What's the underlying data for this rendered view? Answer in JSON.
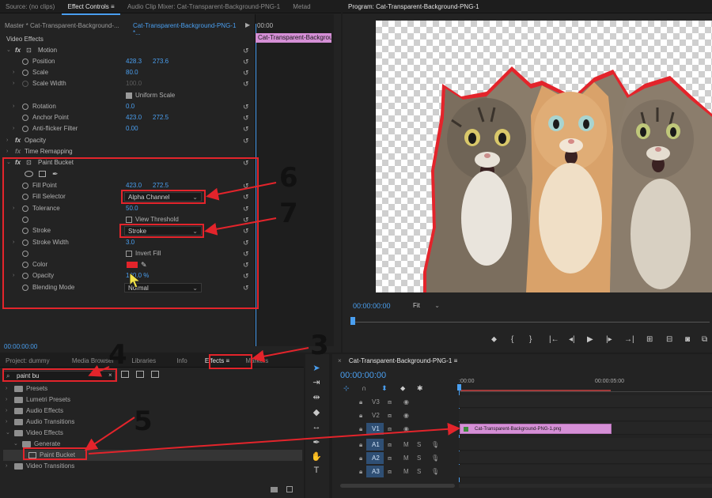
{
  "ec": {
    "tabs": [
      "Source: (no clips)",
      "Effect Controls",
      "Audio Clip Mixer: Cat-Transparent-Background-PNG-1",
      "Metad"
    ],
    "master": "Master * Cat-Transparent-Background-...",
    "sequence_dd": "Cat-Transparent-Background-PNG-1 *...",
    "timeline_time": "00:00",
    "clip_label": "Cat-Transparent-Backgrour",
    "section": "Video Effects",
    "motion": "Motion",
    "position": {
      "label": "Position",
      "x": "428.3",
      "y": "273.6"
    },
    "scale": {
      "label": "Scale",
      "v": "80.0"
    },
    "scale_width": {
      "label": "Scale Width",
      "v": "100.0"
    },
    "uniform_scale": "Uniform Scale",
    "rotation": {
      "label": "Rotation",
      "v": "0.0"
    },
    "anchor": {
      "label": "Anchor Point",
      "x": "423.0",
      "y": "272.5"
    },
    "antiflicker": {
      "label": "Anti-flicker Filter",
      "v": "0.00"
    },
    "opacity": "Opacity",
    "time_remap": "Time Remapping",
    "paint_bucket": "Paint Bucket",
    "fill_point": {
      "label": "Fill Point",
      "x": "423.0",
      "y": "272.5"
    },
    "fill_selector": {
      "label": "Fill Selector",
      "v": "Alpha Channel"
    },
    "tolerance": {
      "label": "Tolerance",
      "v": "50.0"
    },
    "view_threshold": "View Threshold",
    "stroke": {
      "label": "Stroke",
      "v": "Stroke"
    },
    "stroke_width": {
      "label": "Stroke Width",
      "v": "3.0"
    },
    "invert_fill": "Invert Fill",
    "color": {
      "label": "Color",
      "swatch": "#e3242b"
    },
    "pb_opacity": {
      "label": "Opacity",
      "v": "100.0 %"
    },
    "blend": {
      "label": "Blending Mode",
      "v": "Normal"
    },
    "timecode": "00:00:00:00"
  },
  "program": {
    "title": "Program: Cat-Transparent-Background-PNG-1",
    "timecode": "00:00:00:00",
    "fit": "Fit"
  },
  "project": {
    "tabs": [
      "Project: dummy",
      "Media Browser",
      "Libraries",
      "Info",
      "Effects",
      "Markers"
    ],
    "search": "paint bu",
    "items": [
      "Presets",
      "Lumetri Presets",
      "Audio Effects",
      "Audio Transitions",
      "Video Effects",
      "Generate",
      "Paint Bucket",
      "Video Transitions"
    ]
  },
  "timeline": {
    "title": "Cat-Transparent-Background-PNG-1",
    "timecode": "00:00:00:00",
    "ruler_start": ":00:00",
    "ruler_mid": "00:00:05:00",
    "tracks": [
      "V3",
      "V2",
      "V1",
      "A1",
      "A2",
      "A3"
    ],
    "clip": "Cat-Transparent-Background-PNG-1.png",
    "mute": "M",
    "solo": "S"
  },
  "annotations": [
    "6",
    "7",
    "4",
    "3",
    "5"
  ],
  "colors": {
    "annotation_red": "#e3242b",
    "clip_pink": "#d58fd6",
    "accent_blue": "#4a9ff0"
  }
}
